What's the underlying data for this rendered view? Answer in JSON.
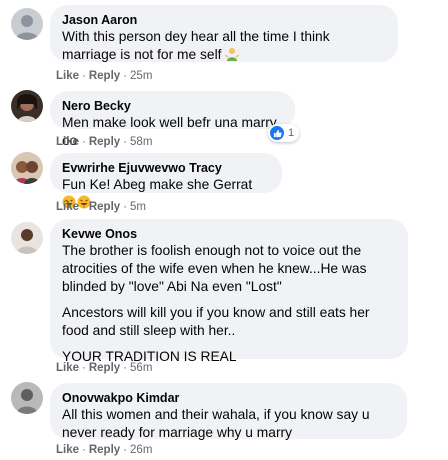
{
  "comments": [
    {
      "name": "Jason Aaron",
      "text": [
        "With this person dey hear all the time I think marriage is not for me self"
      ],
      "emoji": "man-shrugging-icon",
      "like": "Like",
      "reply": "Reply",
      "time": "25m"
    },
    {
      "name": "Nero Becky",
      "text": [
        "Men make look well befr una marry oo"
      ],
      "like": "Like",
      "reply": "Reply",
      "time": "58m",
      "reaction_count": "1",
      "reaction_icon": "like-icon"
    },
    {
      "name": "Evwrirhe Ejuvwevwo Tracy",
      "text": [
        "Fun Ke! Abeg make she Gerrat"
      ],
      "emoji": "laughing-icon",
      "like": "Like",
      "reply": "Reply",
      "time": "5m"
    },
    {
      "name": "Kevwe Onos",
      "text": [
        "The brother is foolish enough not to voice out the atrocities of the wife even when he knew...He was blinded by \"love\" Abi Na even \"Lost\"",
        "Ancestors will kill you if you know and still eats her food and still sleep with her..",
        "YOUR TRADITION IS REAL"
      ],
      "like": "Like",
      "reply": "Reply",
      "time": "56m"
    },
    {
      "name": "Onovwakpo Kimdar",
      "text": [
        "All this women and their wahala, if you know say u never ready for marriage why u marry"
      ],
      "like": "Like",
      "reply": "Reply",
      "time": "26m"
    }
  ],
  "colors": {
    "bubble": "#f0f2f5",
    "meta": "#65676b",
    "like_blue": "#1877f2"
  }
}
